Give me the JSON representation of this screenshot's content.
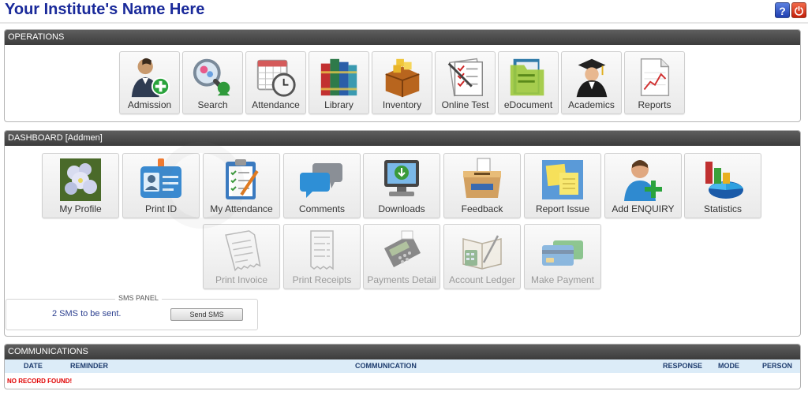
{
  "header": {
    "title": "Your Institute's Name Here",
    "help_label": "?",
    "power_label": "⏻",
    "colors": {
      "title": "#1a2a9a",
      "help": "#1f3fb0",
      "power": "#c4200a"
    }
  },
  "operations": {
    "title": "OPERATIONS",
    "items": [
      {
        "label": "Admission",
        "icon": "admission-icon"
      },
      {
        "label": "Search",
        "icon": "search-icon"
      },
      {
        "label": "Attendance",
        "icon": "attendance-icon"
      },
      {
        "label": "Library",
        "icon": "library-icon"
      },
      {
        "label": "Inventory",
        "icon": "inventory-icon"
      },
      {
        "label": "Online Test",
        "icon": "online-test-icon"
      },
      {
        "label": "eDocument",
        "icon": "edocument-icon"
      },
      {
        "label": "Academics",
        "icon": "academics-icon"
      },
      {
        "label": "Reports",
        "icon": "reports-icon"
      }
    ]
  },
  "dashboard": {
    "title": "DASHBOARD [Addmen]",
    "items": [
      {
        "label": "My Profile",
        "icon": "profile-photo-icon",
        "enabled": true
      },
      {
        "label": "Print ID",
        "icon": "id-card-icon",
        "enabled": true
      },
      {
        "label": "My Attendance",
        "icon": "clipboard-icon",
        "enabled": true
      },
      {
        "label": "Comments",
        "icon": "comments-icon",
        "enabled": true
      },
      {
        "label": "Downloads",
        "icon": "downloads-icon",
        "enabled": true
      },
      {
        "label": "Feedback",
        "icon": "feedback-box-icon",
        "enabled": true
      },
      {
        "label": "Report Issue",
        "icon": "sticky-notes-icon",
        "enabled": true
      },
      {
        "label": "Add ENQUIRY",
        "icon": "add-user-icon",
        "enabled": true
      },
      {
        "label": "Statistics",
        "icon": "statistics-icon",
        "enabled": true
      },
      {
        "label": "Print Invoice",
        "icon": "invoice-icon",
        "enabled": false
      },
      {
        "label": "Print Receipts",
        "icon": "receipt-icon",
        "enabled": false
      },
      {
        "label": "Payments Detail",
        "icon": "card-terminal-icon",
        "enabled": false
      },
      {
        "label": "Account Ledger",
        "icon": "ledger-icon",
        "enabled": false
      },
      {
        "label": "Make Payment",
        "icon": "credit-card-icon",
        "enabled": false
      }
    ]
  },
  "sms_panel": {
    "legend": "SMS PANEL",
    "count_text": "2 SMS to be sent.",
    "send_label": "Send SMS"
  },
  "communications": {
    "title": "COMMUNICATIONS",
    "columns": [
      "DATE",
      "REMINDER",
      "COMMUNICATION",
      "RESPONSE",
      "MODE",
      "PERSON"
    ],
    "empty_message": "NO RECORD FOUND!"
  }
}
